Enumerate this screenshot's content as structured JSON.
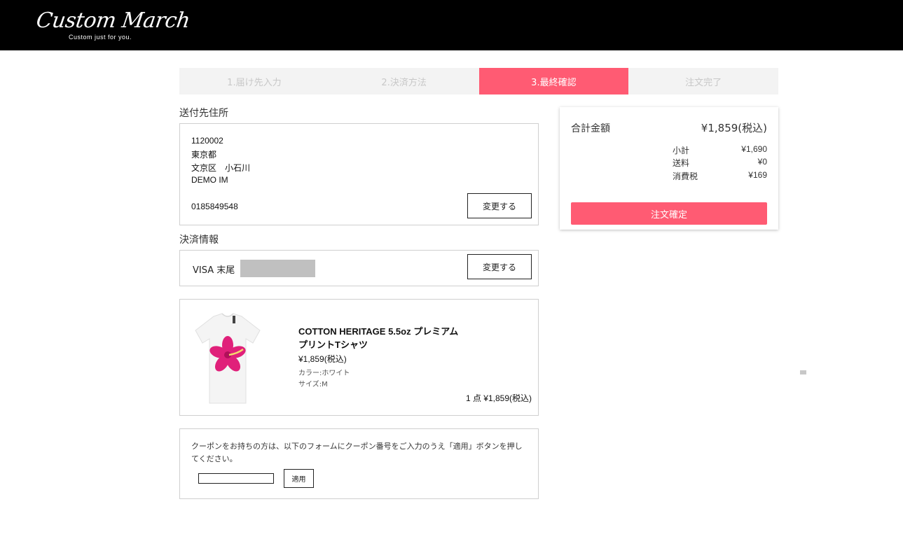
{
  "brand": {
    "name": "Custom March",
    "tagline": "Custom just for you."
  },
  "steps": [
    {
      "label": "1.届け先入力",
      "active": false
    },
    {
      "label": "2.決済方法",
      "active": false
    },
    {
      "label": "3.最終確認",
      "active": true
    },
    {
      "label": "注文完了",
      "active": false
    }
  ],
  "address": {
    "heading": "送付先住所",
    "postal_code": "1120002",
    "prefecture": "東京都",
    "city": "文京区　小石川",
    "name": "DEMO IM",
    "phone": "0185849548",
    "change_label": "変更する"
  },
  "payment": {
    "heading": "決済情報",
    "text": "VISA 末尾",
    "change_label": "変更する"
  },
  "product": {
    "name": "COTTON HERITAGE 5.5oz プレミアムプリントTシャツ",
    "price": "¥1,859(税込)",
    "color": "カラー:ホワイト",
    "size": "サイズ:M",
    "total": "1 点 ¥1,859(税込)"
  },
  "coupon": {
    "text": "クーポンをお持ちの方は、以下のフォームにクーポン番号をご入力のうえ「適用」ボタンを押してください。",
    "input_value": "",
    "apply_label": "適用"
  },
  "summary": {
    "total_label": "合計金額",
    "total_value": "¥1,859(税込)",
    "rows": [
      {
        "label": "小計",
        "value": "¥1,690"
      },
      {
        "label": "送料",
        "value": "¥0"
      },
      {
        "label": "消費税",
        "value": "¥169"
      }
    ],
    "confirm_label": "注文確定"
  },
  "colors": {
    "accent": "#ff5b73",
    "header_bg": "#000000",
    "step_bg": "#f3f3f3"
  }
}
